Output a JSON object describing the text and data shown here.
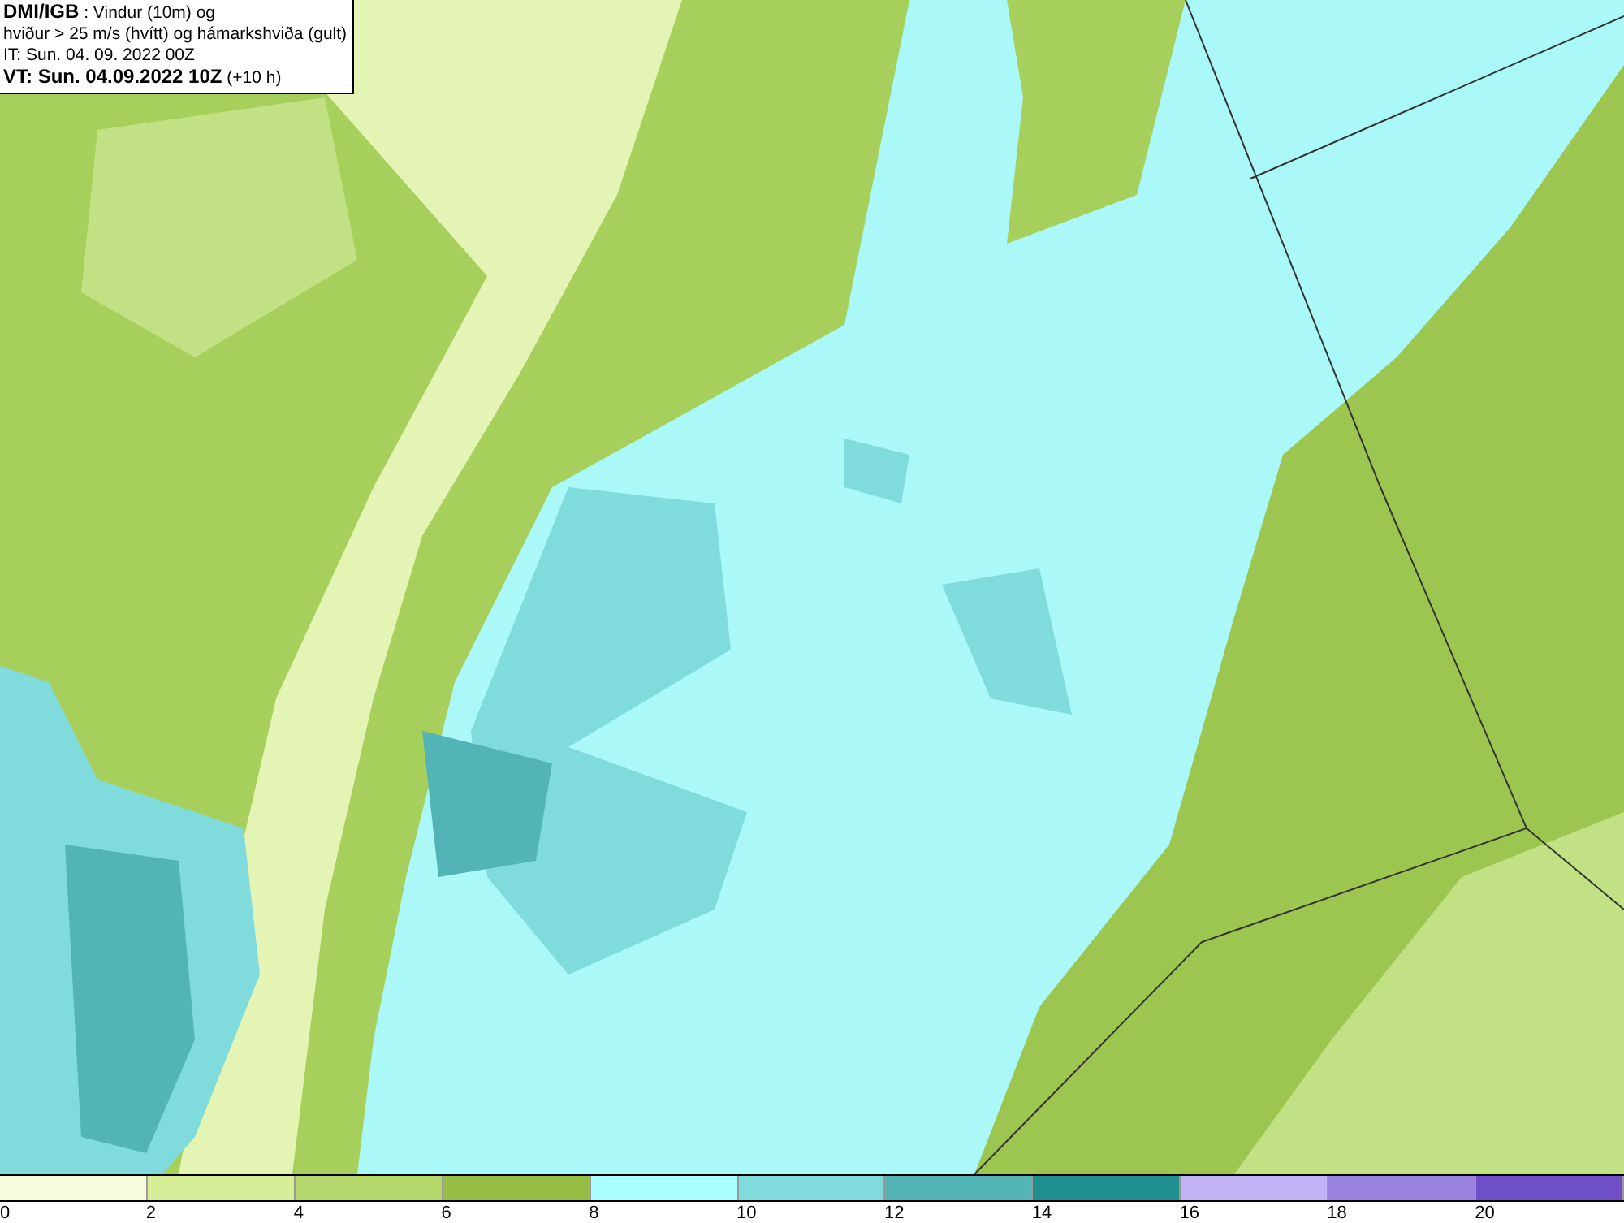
{
  "title_box": {
    "lines": [
      "**DMI/IGB** : Vindur (10m) og",
      "hviður > 25 m/s (hvítt) og hámarkshviða (gult)",
      "IT: Sun. 04. 09. 2022 00Z",
      "**VT: Sun. 04.09.2022 10Z** (+10 h)"
    ]
  },
  "legend": {
    "bins": [
      {
        "color": "#f4fcdc"
      },
      {
        "color": "#d6ee98"
      },
      {
        "color": "#b4d76c"
      },
      {
        "color": "#96bd44"
      },
      {
        "color": "#aaffff"
      },
      {
        "color": "#80dcdc"
      },
      {
        "color": "#52b4b4"
      },
      {
        "color": "#208f8f"
      },
      {
        "color": "#c4b2f7"
      },
      {
        "color": "#9a82e0"
      },
      {
        "color": "#7050c8"
      }
    ],
    "ticks": [
      "0",
      "2",
      "4",
      "6",
      "8",
      "10",
      "12",
      "14",
      "16",
      "18",
      "20"
    ]
  }
}
